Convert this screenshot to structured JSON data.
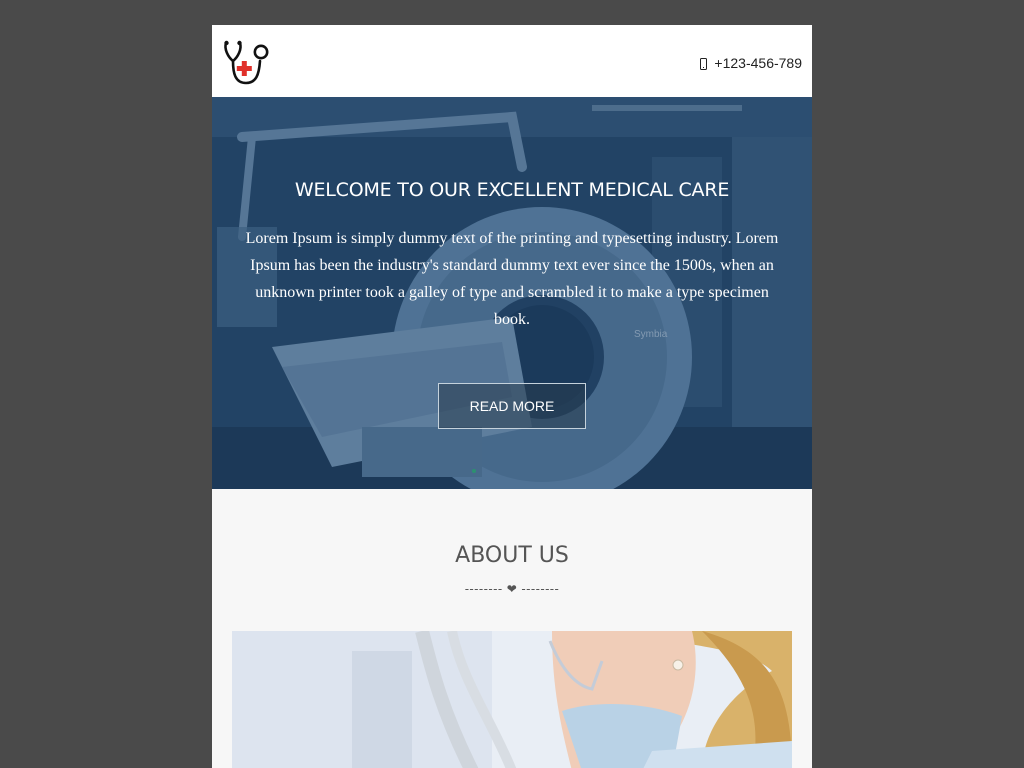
{
  "header": {
    "logo_icon": "stethoscope-cross-icon",
    "phone_icon": "mobile-phone-icon",
    "phone": "+123-456-789"
  },
  "hero": {
    "title": "WELCOME TO OUR EXCELLENT MEDICAL CARE",
    "text": "Lorem Ipsum is simply dummy text of the printing and typesetting industry. Lorem Ipsum has been the industry's standard dummy text ever since the 1500s, when an unknown printer took a galley of type and scrambled it to make a type specimen book.",
    "button_label": "READ MORE",
    "background_image": "medical-scanner-room-photo",
    "scanner_brand": "Symbia"
  },
  "about": {
    "title": "ABOUT US",
    "divider": "-------- ❤ --------",
    "image": "dentist-with-mask-photo"
  },
  "colors": {
    "page_background": "#4a4a4a",
    "hero_overlay": "#1a4a75",
    "logo_red": "#e0302a",
    "about_background": "#f7f7f7",
    "heading_gray": "#555555"
  }
}
